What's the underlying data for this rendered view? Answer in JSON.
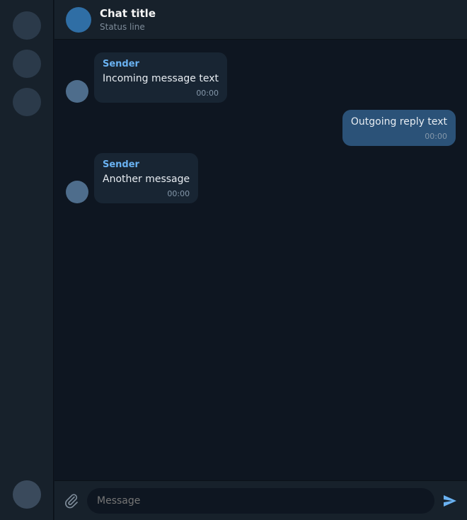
{
  "chat": {
    "title": "Chat title",
    "subtitle": "Status line"
  },
  "messages": [
    {
      "direction": "in",
      "author": "Sender",
      "text": "Incoming message text",
      "time": "00:00"
    },
    {
      "direction": "out",
      "author": "",
      "text": "Outgoing reply text",
      "time": "00:00"
    },
    {
      "direction": "in",
      "author": "Sender",
      "text": "Another message",
      "time": "00:00"
    }
  ],
  "composer": {
    "placeholder": "Message"
  },
  "icons": {
    "attach": "paperclip-icon",
    "send": "send-icon"
  },
  "colors": {
    "background": "#0e1621",
    "panel": "#17212b",
    "incoming_bubble": "#182533",
    "outgoing_bubble": "#2b5278",
    "accent": "#6ab2f2"
  }
}
